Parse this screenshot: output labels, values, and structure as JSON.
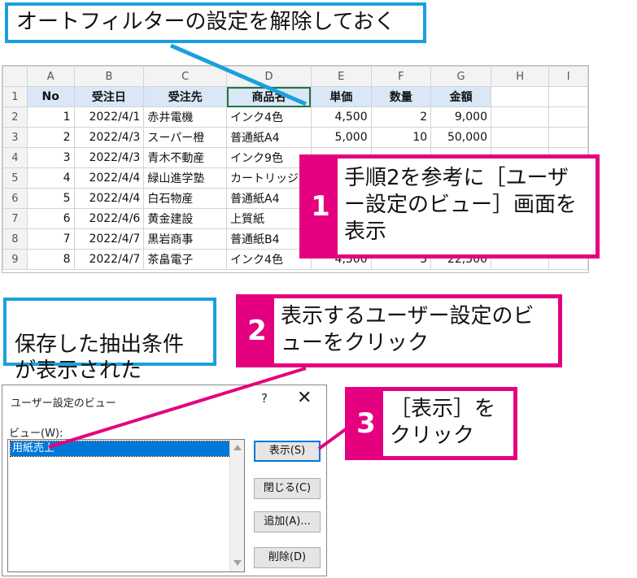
{
  "callout_top": "オートフィルターの設定を解除しておく",
  "callout_saved": "保存した抽出条件\nが表示された",
  "callout1": {
    "num": "1",
    "text": "手順2を参考に［ユーザー設定のビュー］画面を表示"
  },
  "callout2": {
    "num": "2",
    "text": "表示するユーザー設定のビューをクリック"
  },
  "callout3": {
    "num": "3",
    "text": "［表示］をクリック"
  },
  "colors": {
    "blue_border": "#1aa0db",
    "pink": "#e4007f",
    "header_fill": "#d9e7f7",
    "select_blue": "#0078d7"
  },
  "sheet": {
    "col_letters": [
      "A",
      "B",
      "C",
      "D",
      "E",
      "F",
      "G",
      "H",
      "I"
    ],
    "headers": [
      "No",
      "受注日",
      "受注先",
      "商品名",
      "単価",
      "数量",
      "金額"
    ],
    "rows": [
      [
        "1",
        "2022/4/1",
        "赤井電機",
        "インク4色",
        "4,500",
        "2",
        "9,000"
      ],
      [
        "2",
        "2022/4/3",
        "スーパー橙",
        "普通紙A4",
        "5,000",
        "10",
        "50,000"
      ],
      [
        "3",
        "2022/4/3",
        "青木不動産",
        "インク9色",
        "",
        "",
        ""
      ],
      [
        "4",
        "2022/4/4",
        "緑山進学塾",
        "カートリッジ",
        "",
        "",
        ""
      ],
      [
        "5",
        "2022/4/4",
        "白石物産",
        "普通紙A4",
        "",
        "",
        ""
      ],
      [
        "6",
        "2022/4/6",
        "黄金建設",
        "上質紙",
        "",
        "",
        ""
      ],
      [
        "7",
        "2022/4/7",
        "黒岩商事",
        "普通紙B4",
        "",
        "",
        ""
      ],
      [
        "8",
        "2022/4/7",
        "茶畠電子",
        "インク4色",
        "4,500",
        "5",
        "22,500"
      ]
    ]
  },
  "dialog": {
    "title": "ユーザー設定のビュー",
    "help": "?",
    "close": "✕",
    "list_label": "ビュー(W):",
    "list_items": [
      "用紙売上"
    ],
    "buttons": {
      "show": "表示(S)",
      "close": "閉じる(C)",
      "add": "追加(A)...",
      "delete": "削除(D)"
    }
  }
}
